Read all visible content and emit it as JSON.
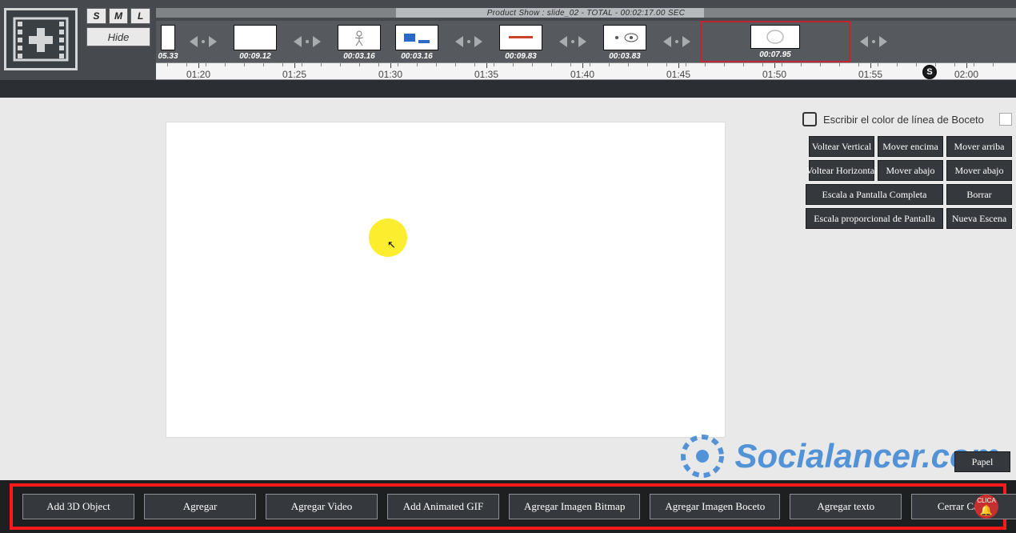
{
  "project": {
    "title": "Product Show : slide_02 - TOTAL - 00:02:17.00 SEC"
  },
  "sizeButtons": {
    "s": "S",
    "m": "M",
    "l": "L",
    "hide": "Hide"
  },
  "clips": [
    {
      "time": "05.33"
    },
    {
      "time": "00:09.12"
    },
    {
      "time": "00:03.16"
    },
    {
      "time": "00:03.16"
    },
    {
      "time": "00:09.83"
    },
    {
      "time": "00:03.83"
    },
    {
      "time": "00:07.95"
    }
  ],
  "ruler": {
    "labels": [
      "01:20",
      "01:25",
      "01:30",
      "01:35",
      "01:40",
      "01:45",
      "01:50",
      "01:55",
      "02:00"
    ],
    "scrub": "S"
  },
  "sketchColor": {
    "label": "Escribir el color de línea de Boceto"
  },
  "rightButtons": {
    "flipV": "Voltear Vertical",
    "moveOver": "Mover encima",
    "moveUp": "Mover arriba",
    "flipH": "Voltear Horizontal",
    "moveDown1": "Mover abajo",
    "moveDown2": "Mover abajo",
    "scaleFull": "Escala a Pantalla Completa",
    "delete": "Borrar",
    "scaleProp": "Escala proporcional de Pantalla",
    "newScene": "Nueva Escena",
    "paper": "Papel"
  },
  "watermark": {
    "text": "Socialancer.com"
  },
  "bottomButtons": {
    "add3d": "Add 3D Object",
    "add": "Agregar",
    "addVideo": "Agregar Video",
    "addGif": "Add Animated GIF",
    "addBitmap": "Agregar Imagen Bitmap",
    "addSketch": "Agregar Imagen Boceto",
    "addText": "Agregar texto",
    "closeCanvas": "Cerrar Canvas"
  },
  "clickBadge": {
    "top": "CLICA"
  }
}
